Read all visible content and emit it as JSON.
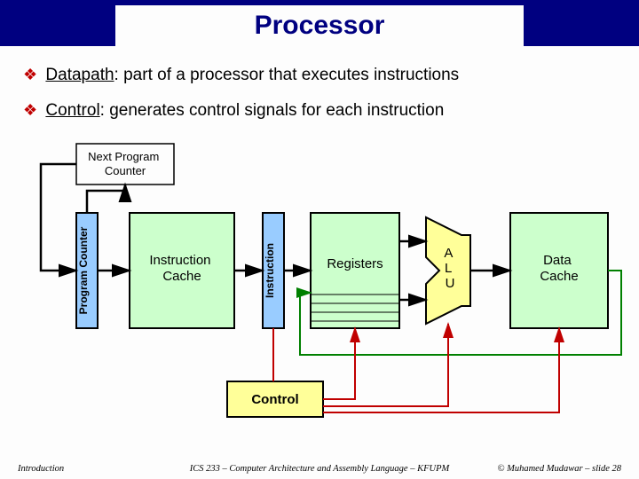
{
  "title": "Processor",
  "bullets": {
    "b1_label": "Datapath",
    "b1_rest": ":  part of a processor that executes instructions",
    "b2_label": "Control",
    "b2_rest": ": generates control signals for each instruction"
  },
  "diagram": {
    "next_pc": "Next Program\nCounter",
    "program_counter": "Program Counter",
    "instruction_cache": "Instruction\nCache",
    "instruction": "Instruction",
    "registers": "Registers",
    "alu": "A\nL\nU",
    "data_cache": "Data\nCache",
    "control": "Control"
  },
  "footer": {
    "left": "Introduction",
    "center": "ICS 233 – Computer Architecture and Assembly Language – KFUPM",
    "right": "© Muhamed Mudawar – slide 28"
  }
}
